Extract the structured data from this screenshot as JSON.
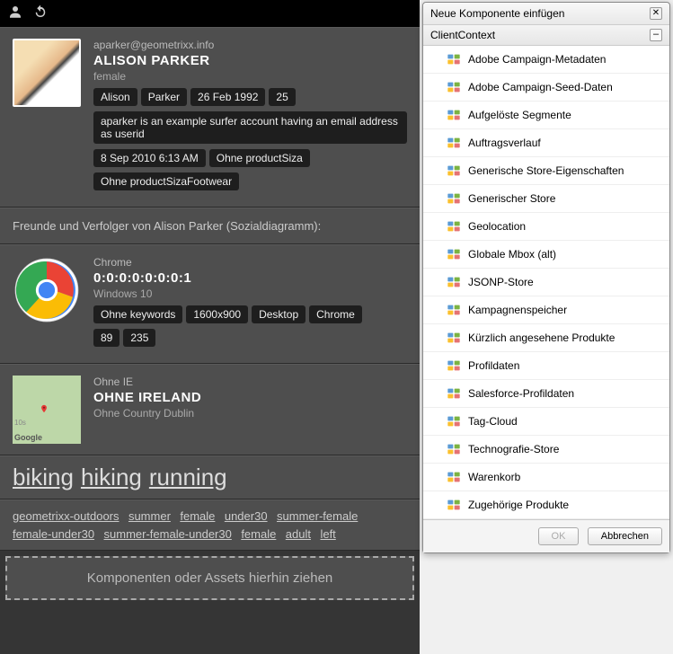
{
  "profile": {
    "email": "aparker@geometrixx.info",
    "name": "ALISON PARKER",
    "gender": "female",
    "pills1": [
      "Alison",
      "Parker",
      "26 Feb 1992",
      "25"
    ],
    "description": "aparker is an example surfer account having an email address as userid",
    "pills2": [
      "8 Sep 2010 6:13 AM",
      "Ohne productSiza"
    ],
    "pills3": [
      "Ohne productSizaFootwear"
    ]
  },
  "social_caption": "Freunde und Verfolger von Alison Parker (Sozialdiagramm):",
  "browser": {
    "name": "Chrome",
    "ip": "0:0:0:0:0:0:0:1",
    "os": "Windows 10",
    "pills1": [
      "Ohne keywords",
      "1600x900",
      "Desktop",
      "Chrome"
    ],
    "pills2": [
      "89",
      "235"
    ]
  },
  "geo": {
    "line1": "Ohne IE",
    "line2": "OHNE IRELAND",
    "line3": "Ohne Country Dublin",
    "attribution": "Google"
  },
  "big_tags": [
    "biking",
    "hiking",
    "running"
  ],
  "small_tags": [
    "geometrixx-outdoors",
    "summer",
    "female",
    "under30",
    "summer-female",
    "female-under30",
    "summer-female-under30",
    "female",
    "adult",
    "left"
  ],
  "dropzone": "Komponenten oder Assets hierhin ziehen",
  "dialog": {
    "title": "Neue Komponente einfügen",
    "group": "ClientContext",
    "items": [
      "Adobe Campaign-Metadaten",
      "Adobe Campaign-Seed-Daten",
      "Aufgelöste Segmente",
      "Auftragsverlauf",
      "Generische Store-Eigenschaften",
      "Generischer Store",
      "Geolocation",
      "Globale Mbox (alt)",
      "JSONP-Store",
      "Kampagnenspeicher",
      "Kürzlich angesehene Produkte",
      "Profildaten",
      "Salesforce-Profildaten",
      "Tag-Cloud",
      "Technografie-Store",
      "Warenkorb",
      "Zugehörige Produkte"
    ],
    "ok": "OK",
    "cancel": "Abbrechen"
  }
}
